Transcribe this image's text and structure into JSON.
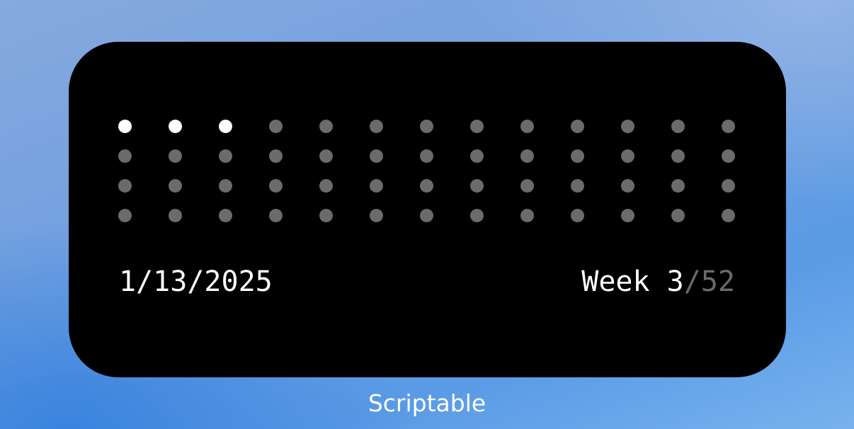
{
  "widget": {
    "date": "1/13/2025",
    "week_prefix": "Week ",
    "week_current": "3",
    "week_total_text": "/52",
    "progress": {
      "weeks_elapsed": 3,
      "weeks_total": 52
    },
    "colors": {
      "background": "#000000",
      "filled_dot": "#ffffff",
      "empty_dot": "#6b6b6b",
      "text": "#ffffff",
      "muted_text": "#6b6b6b"
    }
  },
  "home_screen": {
    "widget_label": "Scriptable"
  }
}
